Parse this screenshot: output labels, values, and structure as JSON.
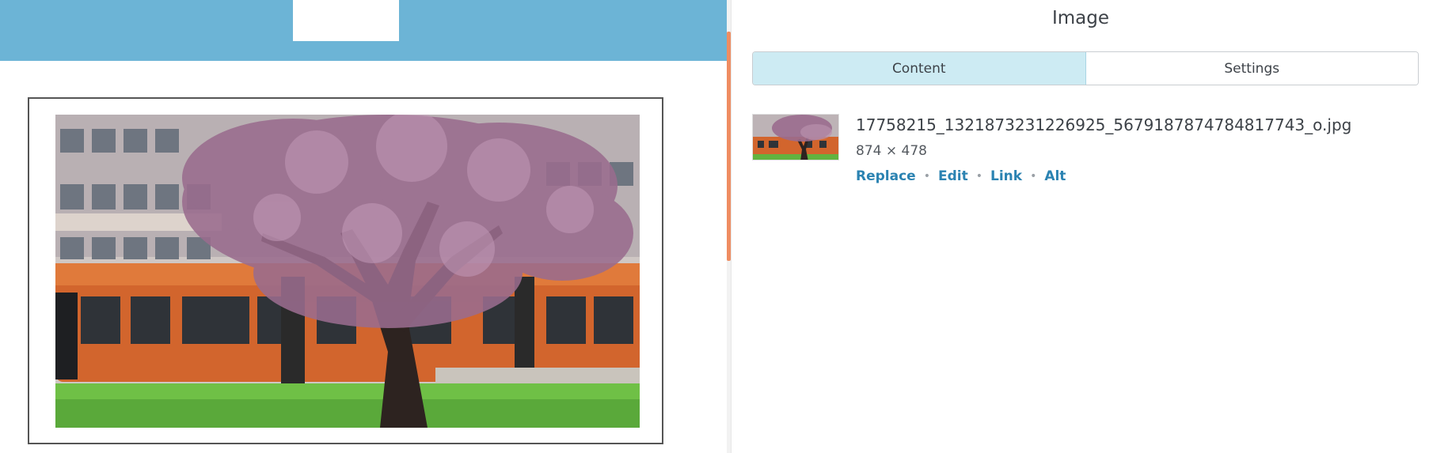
{
  "canvas": {
    "header_color": "#6cb4d6",
    "logo_text": "",
    "image": {
      "description": "tram and cherry tree"
    }
  },
  "panel": {
    "title": "Image",
    "tabs": [
      {
        "label": "Content",
        "active": true
      },
      {
        "label": "Settings",
        "active": false
      }
    ],
    "file": {
      "name": "17758215_1321873231226925_5679187874784817743_o.jpg",
      "dimensions": "874 × 478"
    },
    "actions": [
      {
        "label": "Replace"
      },
      {
        "label": "Edit"
      },
      {
        "label": "Link"
      },
      {
        "label": "Alt"
      }
    ]
  },
  "colors": {
    "accent": "#2b83b2",
    "active_tab": "#cdebf3",
    "scroll_thumb": "#ef8d62"
  }
}
